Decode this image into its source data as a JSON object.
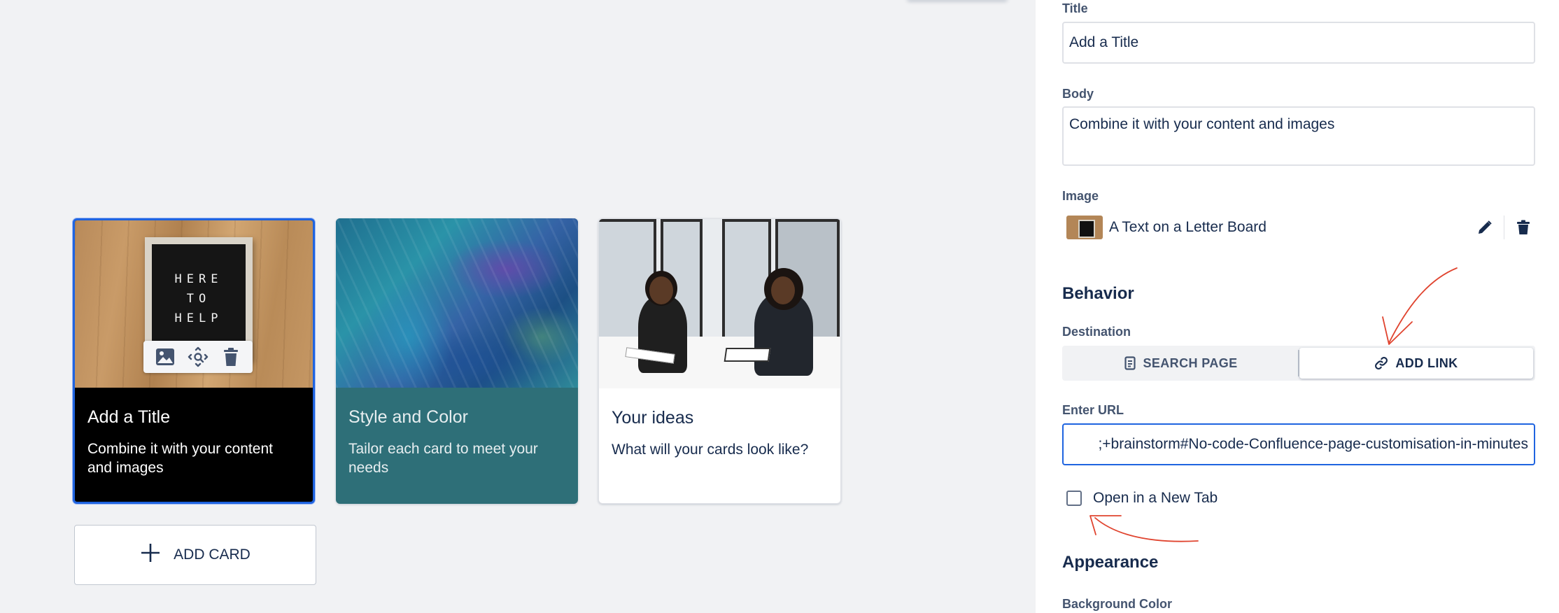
{
  "cards": [
    {
      "title": "Add a Title",
      "body": "Combine it with your content and images",
      "board_text": [
        "HERE",
        "TO",
        "HELP"
      ]
    },
    {
      "title": "Style and Color",
      "body": "Tailor each card to meet your needs"
    },
    {
      "title": "Your ideas",
      "body": "What will your cards look like?"
    }
  ],
  "image_toolbar": {
    "icons": [
      "image-icon",
      "focal-point-icon",
      "trash-icon"
    ]
  },
  "add_card": {
    "label": "ADD CARD",
    "icon": "plus-icon"
  },
  "panel": {
    "title_label": "Title",
    "title_value": "Add a Title",
    "body_label": "Body",
    "body_value": "Combine it with your content and images",
    "image_label": "Image",
    "image_name": "A Text on a Letter Board",
    "behavior_heading": "Behavior",
    "destination_label": "Destination",
    "destination_options": [
      {
        "label": "SEARCH PAGE",
        "icon": "document-icon",
        "active": false
      },
      {
        "label": "ADD LINK",
        "icon": "link-icon",
        "active": true
      }
    ],
    "url_label": "Enter URL",
    "url_value": ";+brainstorm#No-code-Confluence-page-customisation-in-minutes",
    "new_tab_label": "Open in a New Tab",
    "new_tab_checked": false,
    "appearance_heading": "Appearance",
    "background_color_label": "Background Color"
  },
  "colors": {
    "selected_border": "#1f64e0",
    "card2_bg": "#2e6f78",
    "annotation": "#e0442f"
  }
}
